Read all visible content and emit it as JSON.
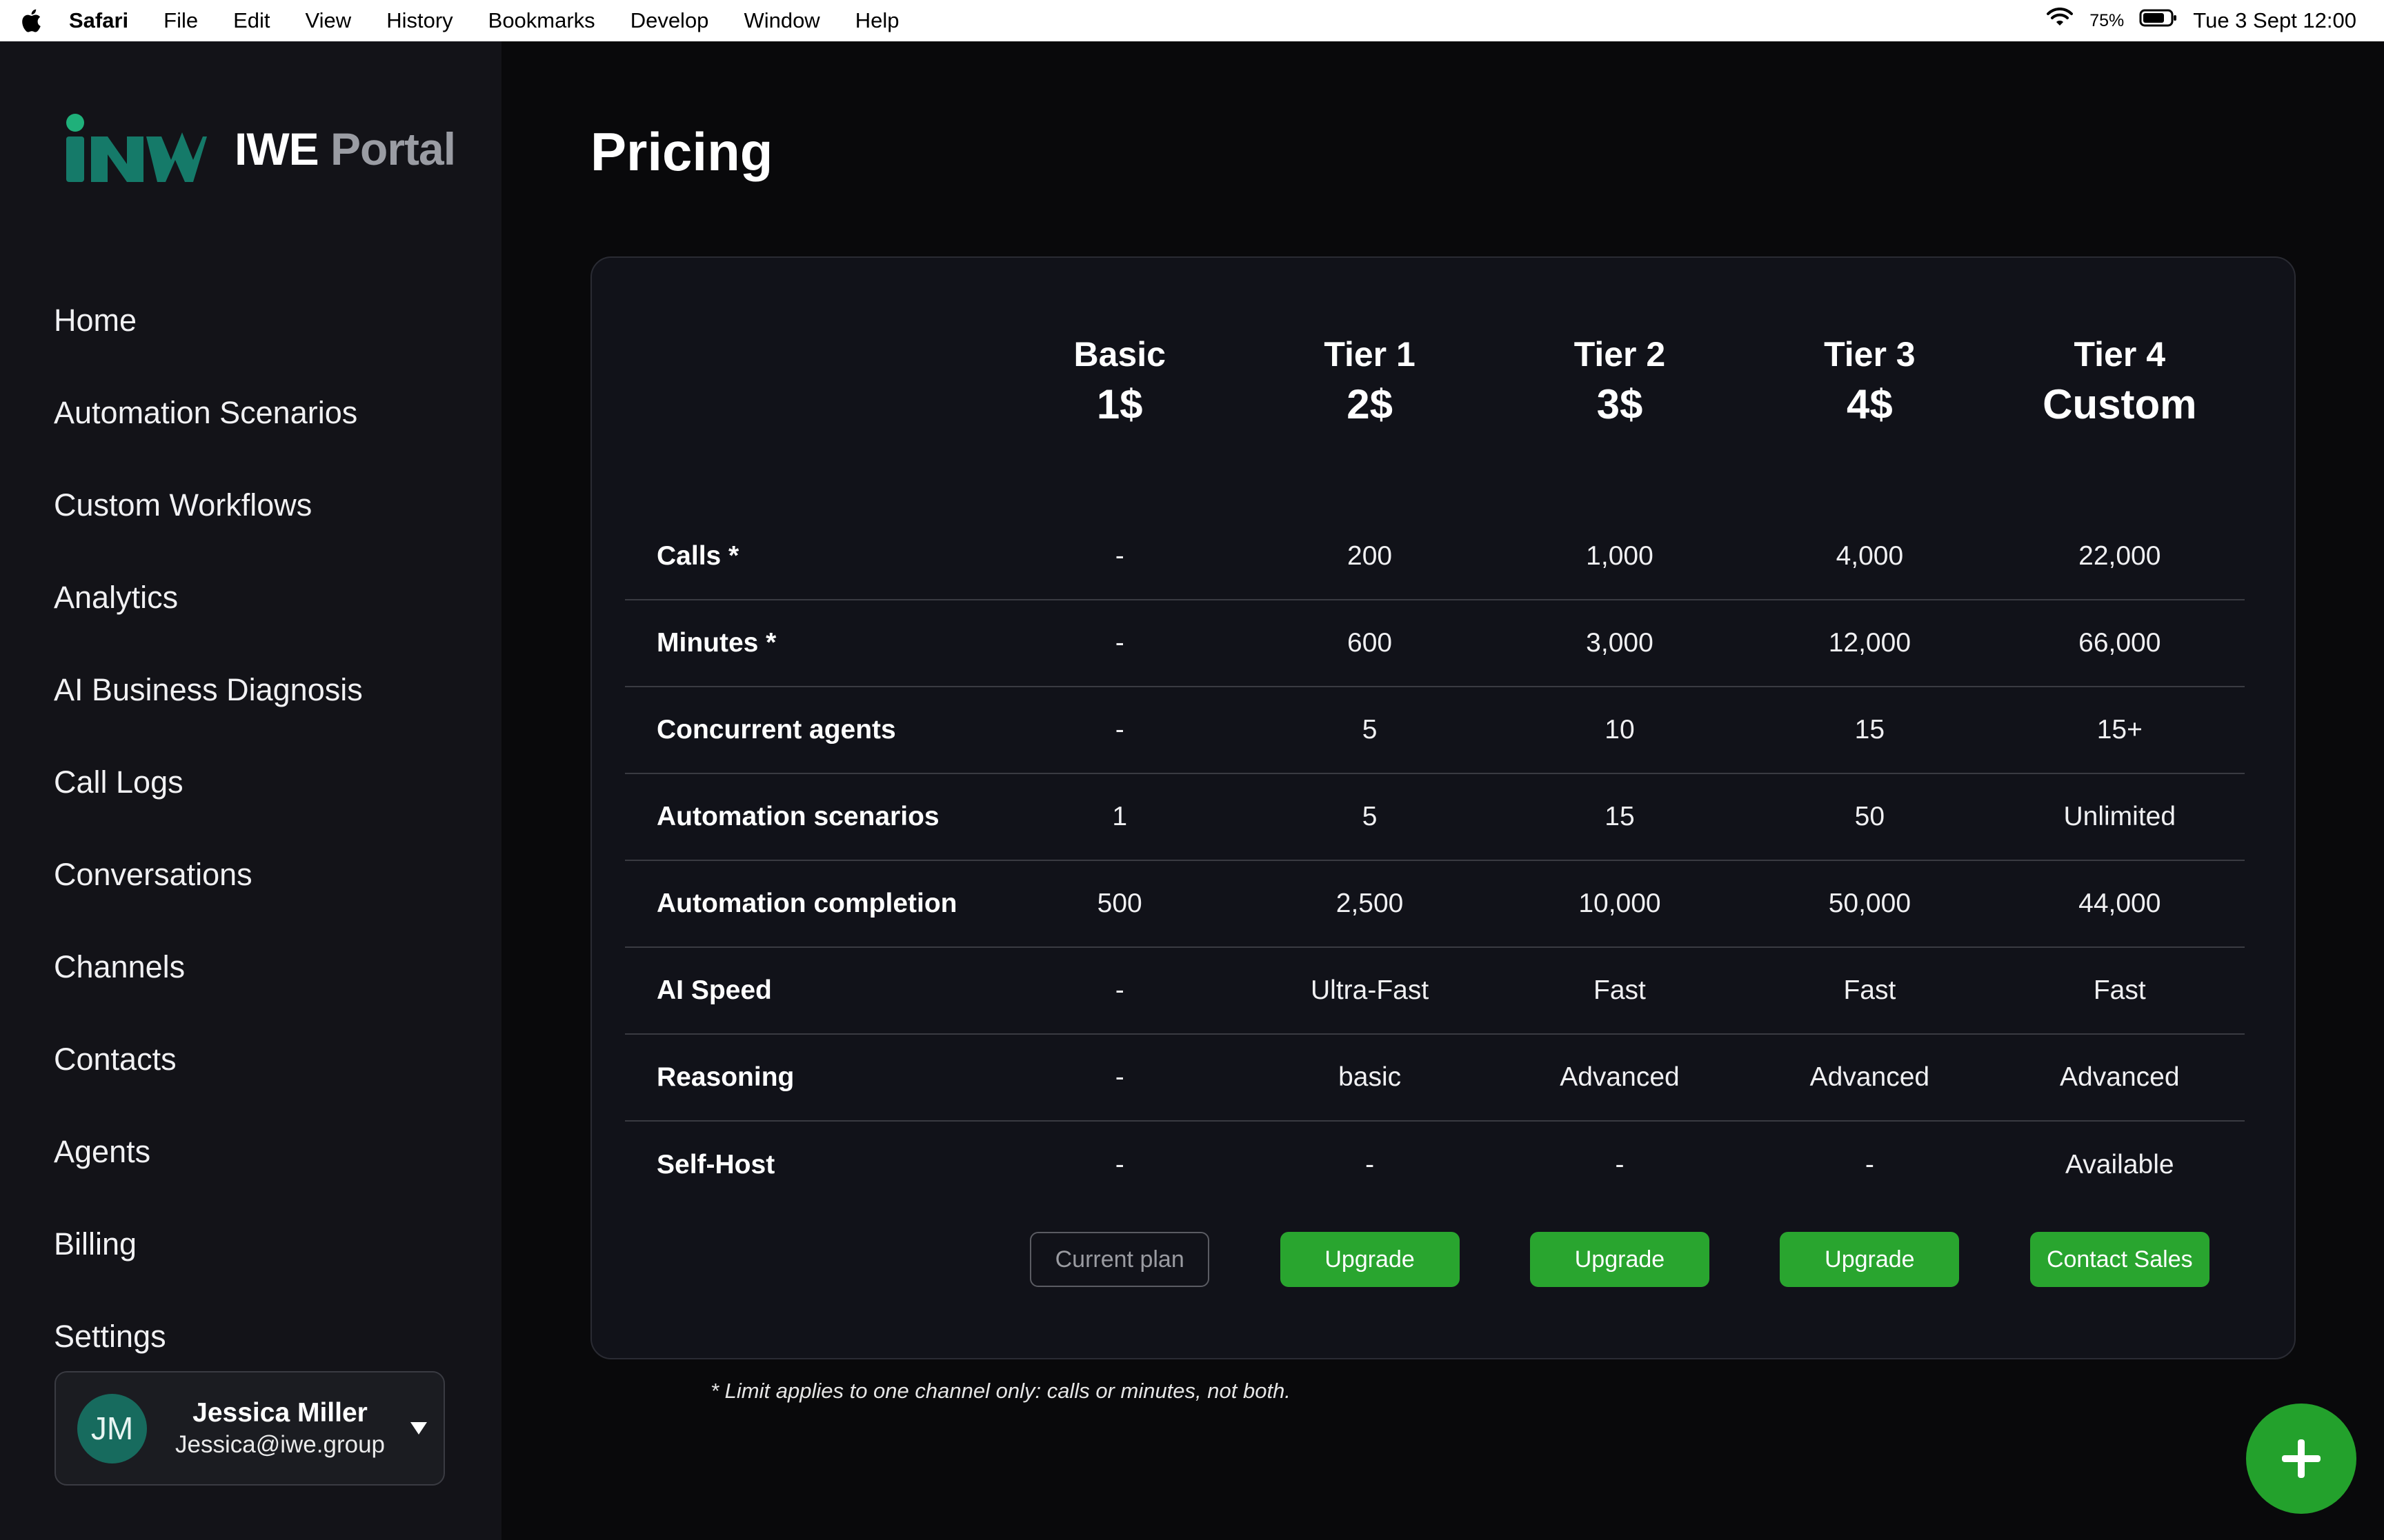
{
  "menubar": {
    "app": "Safari",
    "items": [
      "File",
      "Edit",
      "View",
      "History",
      "Bookmarks",
      "Develop",
      "Window",
      "Help"
    ],
    "battery_pct": "75%",
    "datetime": "Tue 3 Sept  12:00"
  },
  "brand": {
    "name_bold": "IWE",
    "name_light": "Portal",
    "logo_color": "#147a6a",
    "logo_accent": "#1fb07a"
  },
  "sidebar": {
    "items": [
      {
        "label": "Home"
      },
      {
        "label": "Automation Scenarios"
      },
      {
        "label": "Custom Workflows"
      },
      {
        "label": "Analytics"
      },
      {
        "label": "AI Business Diagnosis"
      },
      {
        "label": "Call Logs"
      },
      {
        "label": "Conversations"
      },
      {
        "label": "Channels"
      },
      {
        "label": "Contacts"
      },
      {
        "label": "Agents"
      },
      {
        "label": "Billing"
      },
      {
        "label": "Settings"
      }
    ]
  },
  "user": {
    "initials": "JM",
    "name": "Jessica Miller",
    "email": "Jessica@iwe.group"
  },
  "page": {
    "title": "Pricing"
  },
  "pricing": {
    "tiers": [
      {
        "name": "Basic",
        "price": "1$",
        "button": "Current plan"
      },
      {
        "name": "Tier 1",
        "price": "2$",
        "button": "Upgrade"
      },
      {
        "name": "Tier 2",
        "price": "3$",
        "button": "Upgrade"
      },
      {
        "name": "Tier 3",
        "price": "4$",
        "button": "Upgrade"
      },
      {
        "name": "Tier 4",
        "price": "Custom",
        "button": "Contact Sales"
      }
    ],
    "rows": [
      {
        "feature": "Calls *",
        "values": [
          "-",
          "200",
          "1,000",
          "4,000",
          "22,000"
        ]
      },
      {
        "feature": "Minutes *",
        "values": [
          "-",
          "600",
          "3,000",
          "12,000",
          "66,000"
        ]
      },
      {
        "feature": "Concurrent agents",
        "values": [
          "-",
          "5",
          "10",
          "15",
          "15+"
        ]
      },
      {
        "feature": "Automation scenarios",
        "values": [
          "1",
          "5",
          "15",
          "50",
          "Unlimited"
        ]
      },
      {
        "feature": "Automation completion",
        "values": [
          "500",
          "2,500",
          "10,000",
          "50,000",
          "44,000"
        ]
      },
      {
        "feature": "AI Speed",
        "values": [
          "-",
          "Ultra-Fast",
          "Fast",
          "Fast",
          "Fast"
        ]
      },
      {
        "feature": "Reasoning",
        "values": [
          "-",
          "basic",
          "Advanced",
          "Advanced",
          "Advanced"
        ]
      },
      {
        "feature": "Self-Host",
        "values": [
          "-",
          "-",
          "-",
          "-",
          "Available"
        ]
      }
    ],
    "footnote": "* Limit applies to one channel only: calls or minutes, not both."
  },
  "colors": {
    "accent_green": "#29a52f",
    "background": "#09090b",
    "sidebar": "#131318",
    "card": "#111219"
  },
  "icons": {
    "fab": "plus-icon",
    "menubar": [
      "apple-icon",
      "wifi-icon",
      "battery-icon"
    ]
  }
}
